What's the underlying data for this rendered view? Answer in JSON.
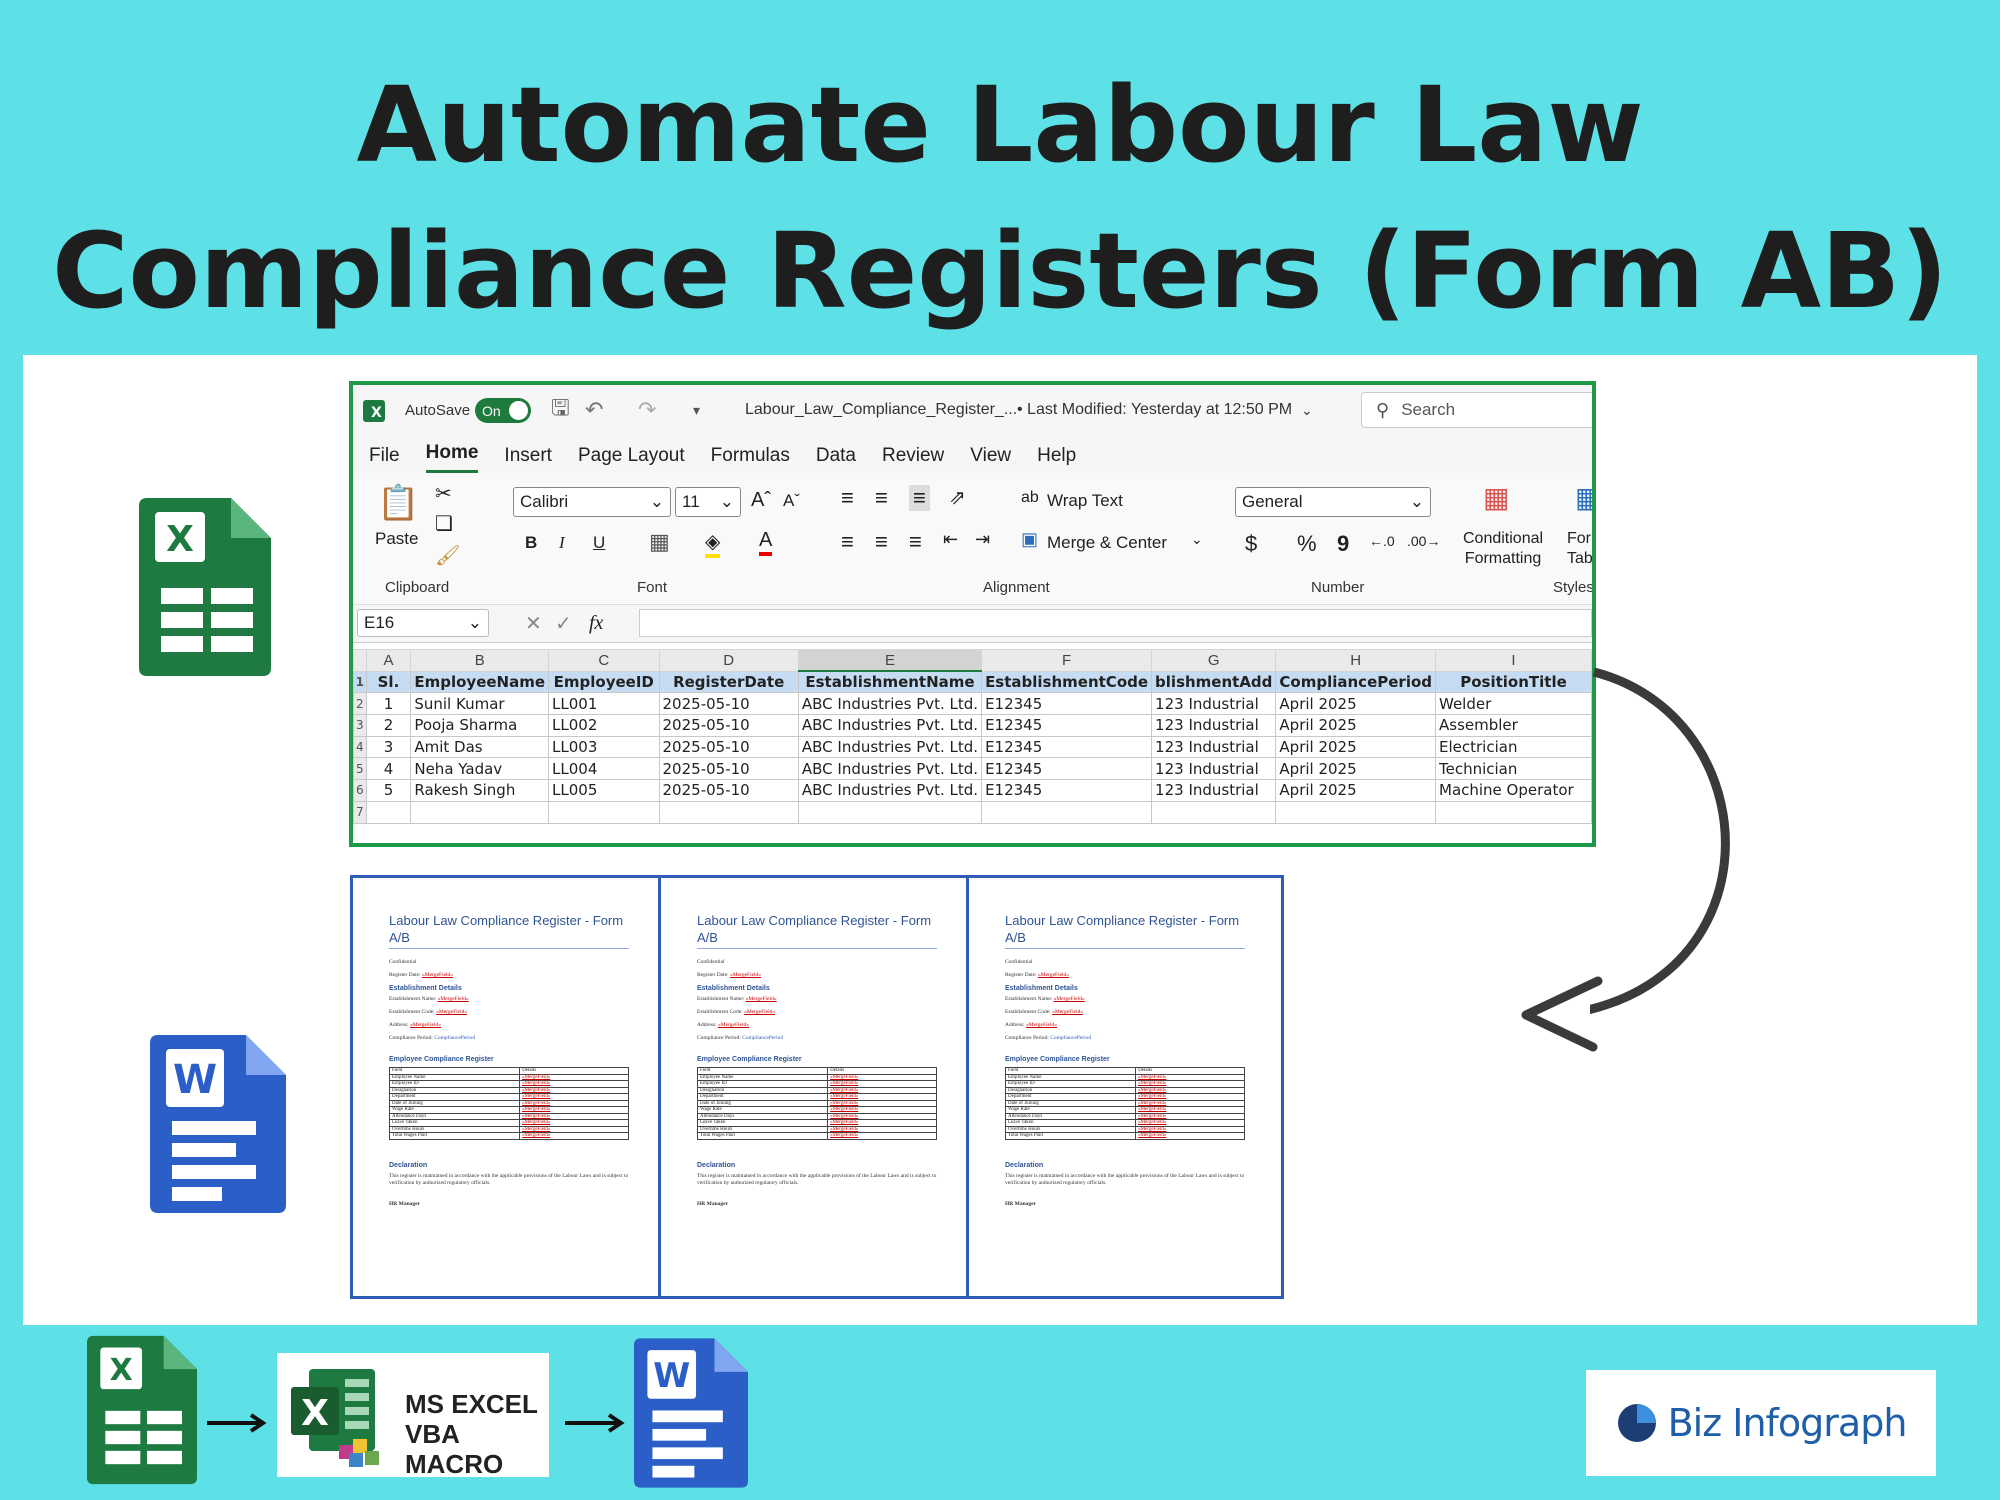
{
  "page": {
    "title_line1": "Automate Labour Law",
    "title_line2": "Compliance Registers (Form AB)"
  },
  "excel": {
    "autosave_label": "AutoSave",
    "autosave_state": "On",
    "filename": "Labour_Law_Compliance_Register_...",
    "last_modified": "• Last Modified: Yesterday at 12:50 PM",
    "search_placeholder": "Search",
    "menu": [
      "File",
      "Home",
      "Insert",
      "Page Layout",
      "Formulas",
      "Data",
      "Review",
      "View",
      "Help"
    ],
    "active_menu": "Home",
    "ribbon": {
      "paste": "Paste",
      "clipboard": "Clipboard",
      "font_name": "Calibri",
      "font_size": "11",
      "font": "Font",
      "wrap_text": "Wrap Text",
      "merge_center": "Merge & Center",
      "alignment": "Alignment",
      "number_format": "General",
      "number": "Number",
      "conditional": "Conditional",
      "formatting": "Formatting",
      "form": "Form",
      "tab": "Tab",
      "styles": "Styles",
      "bold": "B",
      "italic": "I",
      "underline": "U",
      "dollar": "$",
      "percent": "%",
      "comma": "9"
    },
    "name_box": "E16",
    "fx": "fx",
    "columns": [
      "A",
      "B",
      "C",
      "D",
      "E",
      "F",
      "G",
      "H",
      "I"
    ],
    "headers": [
      "Sl.",
      "EmployeeName",
      "EmployeeID",
      "RegisterDate",
      "EstablishmentName",
      "EstablishmentCode",
      "blishmentAdd",
      "CompliancePeriod",
      "PositionTitle"
    ],
    "rows": [
      [
        "1",
        "Sunil Kumar",
        "LL001",
        "2025-05-10",
        "ABC Industries Pvt. Ltd.",
        "E12345",
        "123 Industrial",
        "April 2025",
        "Welder"
      ],
      [
        "2",
        "Pooja Sharma",
        "LL002",
        "2025-05-10",
        "ABC Industries Pvt. Ltd.",
        "E12345",
        "123 Industrial",
        "April 2025",
        "Assembler"
      ],
      [
        "3",
        "Amit Das",
        "LL003",
        "2025-05-10",
        "ABC Industries Pvt. Ltd.",
        "E12345",
        "123 Industrial",
        "April 2025",
        "Electrician"
      ],
      [
        "4",
        "Neha Yadav",
        "LL004",
        "2025-05-10",
        "ABC Industries Pvt. Ltd.",
        "E12345",
        "123 Industrial",
        "April 2025",
        "Technician"
      ],
      [
        "5",
        "Rakesh Singh",
        "LL005",
        "2025-05-10",
        "ABC Industries Pvt. Ltd.",
        "E12345",
        "123 Industrial",
        "April 2025",
        "Machine Operator"
      ]
    ],
    "row_numbers": [
      "1",
      "2",
      "3",
      "4",
      "5",
      "6",
      "7"
    ]
  },
  "word_doc": {
    "heading": "Labour Law Compliance Register - Form A/B",
    "confidential": "Confidential",
    "register_date": "Register Date:",
    "establishment_details": "Establishment Details",
    "est_name": "Establishment Name:",
    "est_code": "Establishment Code:",
    "address": "Address:",
    "compliance_period": "Compliance Period:",
    "compliance_period_value": "CompliancePeriod",
    "employee_register": "Employee Compliance Register",
    "table_fields": [
      "Field",
      "Employee Name",
      "Employee ID",
      "Designation",
      "Department",
      "Date of Joining",
      "Wage Rate",
      "Attendance Days",
      "Leave Taken",
      "Overtime Hours",
      "Total Wages Paid"
    ],
    "table_details": "Details",
    "declaration": "Declaration",
    "declaration_text": "This register is maintained in accordance with the applicable provisions of the Labour Laws and is subject to verification by authorized regulatory officials.",
    "signature": "HR Manager",
    "placeholder": "«MergeField»"
  },
  "bottom": {
    "vba_line1": "MS EXCEL",
    "vba_line2": "VBA MACRO",
    "brand": "Biz Infograph"
  },
  "colors": {
    "background": "#5de0e6",
    "excel_green": "#1f7a3d",
    "word_blue": "#2b5fc7",
    "header_fill": "#c5dcf2"
  }
}
